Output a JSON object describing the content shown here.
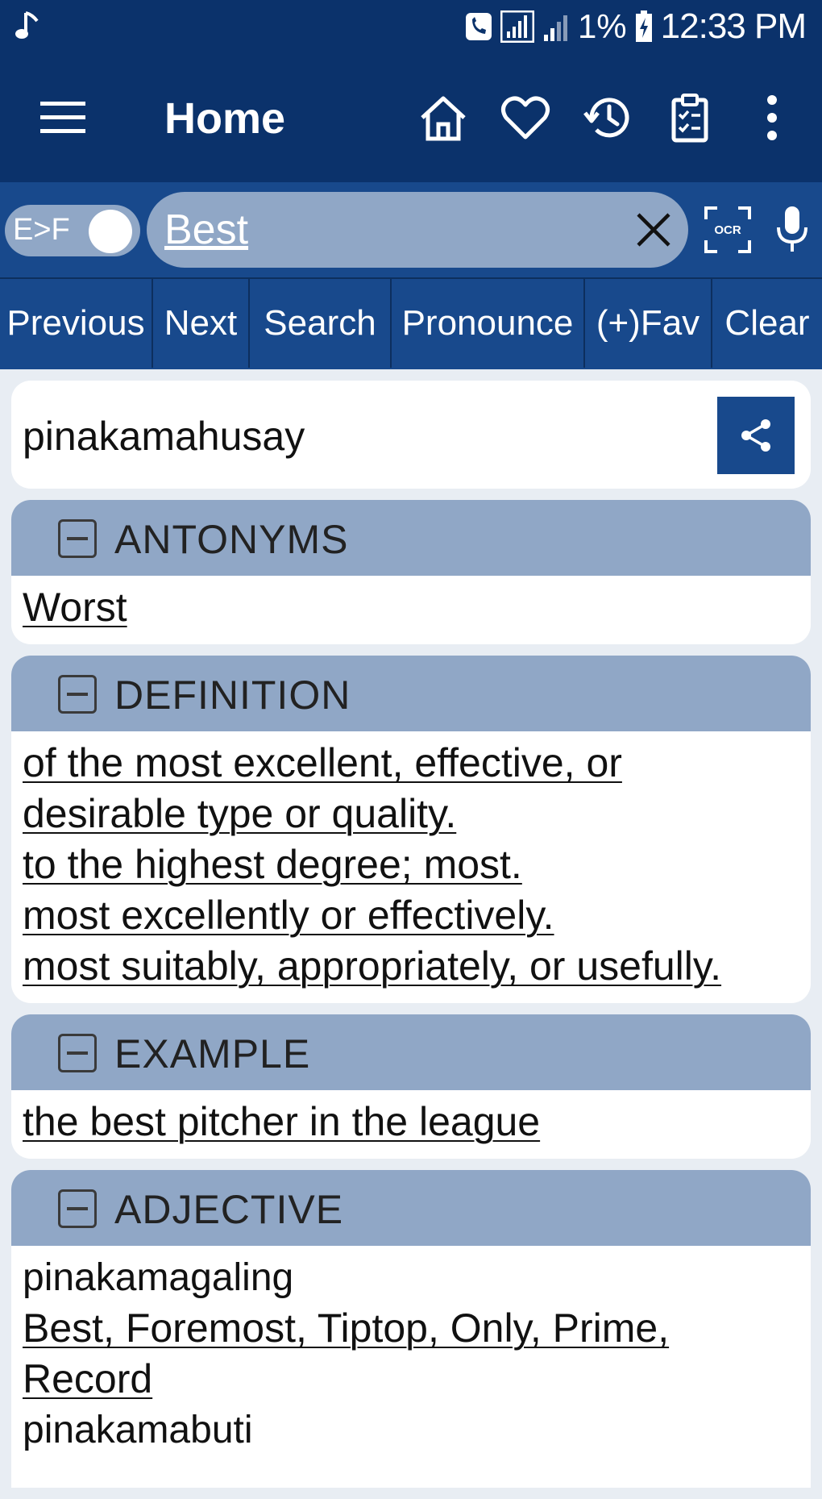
{
  "status_bar": {
    "battery": "1%",
    "time": "12:33 PM",
    "icons": [
      "music-note-icon",
      "call-icon",
      "signal-icon",
      "signal-icon",
      "battery-icon"
    ]
  },
  "appbar": {
    "title": "Home",
    "icons": [
      "menu-icon",
      "home-icon",
      "heart-icon",
      "history-icon",
      "clipboard-icon",
      "more-icon"
    ]
  },
  "search": {
    "toggle_label": "E>F",
    "value": "Best",
    "ocr_label": "OCR"
  },
  "toolbar": {
    "buttons": [
      "Previous",
      "Next",
      "Search",
      "Pronounce",
      "(+)Fav",
      "Clear"
    ]
  },
  "result": {
    "word": "pinakamahusay"
  },
  "sections": {
    "antonyms": {
      "heading": "ANTONYMS",
      "words": [
        "Worst"
      ]
    },
    "definition": {
      "heading": "DEFINITION",
      "lines": [
        "of the most excellent, effective, or",
        "desirable type or quality.",
        "to the highest degree; most.",
        "most excellently or effectively.",
        "most suitably, appropriately, or usefully."
      ]
    },
    "example": {
      "heading": "EXAMPLE",
      "lines": [
        "the best pitcher in the league"
      ]
    },
    "adjective": {
      "heading": "ADJECTIVE",
      "entries": [
        {
          "word": "pinakamagaling",
          "lines": [
            "Best, Foremost, Tiptop, Only, Prime,",
            "Record"
          ]
        },
        {
          "word": "pinakamabuti",
          "lines": []
        }
      ]
    }
  },
  "colors": {
    "appbar_bg": "#0b326b",
    "toolbar_bg": "#18498c",
    "section_header_bg": "#90a7c6",
    "page_bg": "#e8edf3",
    "caret": "#1fa890"
  }
}
